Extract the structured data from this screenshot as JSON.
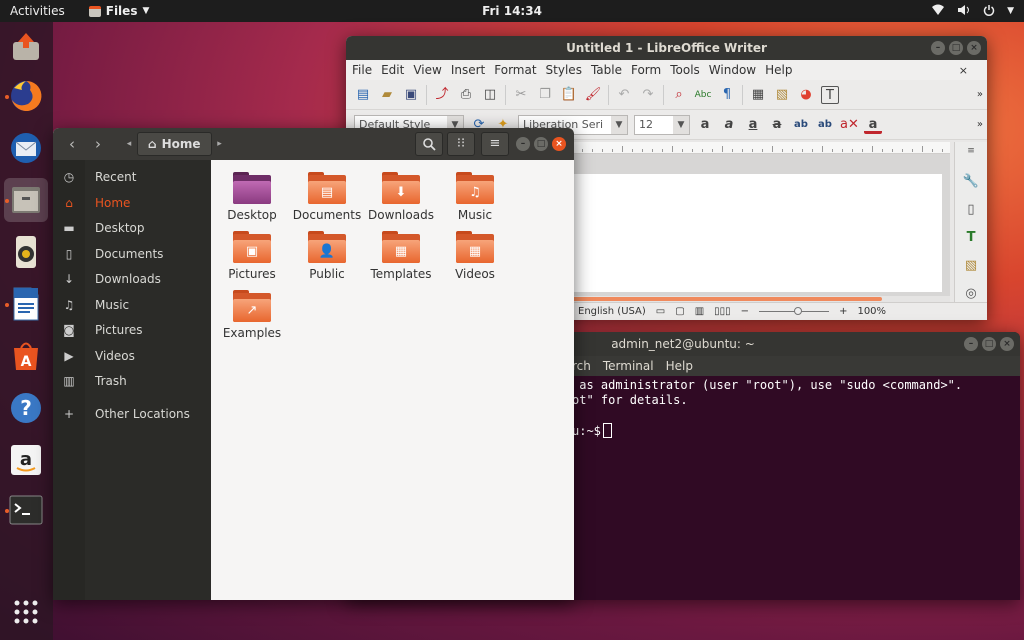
{
  "topbar": {
    "activities": "Activities",
    "app_menu": "Files",
    "clock": "Fri 14:34"
  },
  "dock": [
    "firefox-icon",
    "thunderbird-icon",
    "files-icon",
    "rhythmbox-icon",
    "writer-icon",
    "software-icon",
    "help-icon",
    "amazon-icon",
    "terminal-icon",
    "app-grid-icon"
  ],
  "writer": {
    "title": "Untitled 1 - LibreOffice Writer",
    "menu": [
      "File",
      "Edit",
      "View",
      "Insert",
      "Format",
      "Styles",
      "Table",
      "Form",
      "Tools",
      "Window",
      "Help"
    ],
    "close_doc": "×",
    "para_style": "Default Style",
    "font_name": "Liberation Seri",
    "font_size": "12",
    "language": "English (USA)",
    "zoom": "100%"
  },
  "terminal": {
    "title": "admin_net2@ubuntu: ~",
    "menu": [
      "rch",
      "Terminal",
      "Help"
    ],
    "line1": " as administrator (user \"root\"), use \"sudo <command>\".",
    "line2": "ot\" for details.",
    "prompt": "u:~$"
  },
  "files": {
    "path": "Home",
    "sidebar": [
      {
        "label": "Recent",
        "icon": "clock-icon",
        "glyph": "◷"
      },
      {
        "label": "Home",
        "icon": "home-icon",
        "glyph": "⌂"
      },
      {
        "label": "Desktop",
        "icon": "desktop-icon",
        "glyph": "▬"
      },
      {
        "label": "Documents",
        "icon": "document-icon",
        "glyph": "▯"
      },
      {
        "label": "Downloads",
        "icon": "download-icon",
        "glyph": "↓"
      },
      {
        "label": "Music",
        "icon": "music-icon",
        "glyph": "♫"
      },
      {
        "label": "Pictures",
        "icon": "camera-icon",
        "glyph": "◙"
      },
      {
        "label": "Videos",
        "icon": "video-icon",
        "glyph": "▶"
      },
      {
        "label": "Trash",
        "icon": "trash-icon",
        "glyph": "▥"
      },
      {
        "label": "Other Locations",
        "icon": "plus-icon",
        "glyph": "+"
      }
    ],
    "items": [
      {
        "label": "Desktop",
        "glyph": ""
      },
      {
        "label": "Documents",
        "glyph": "▤"
      },
      {
        "label": "Downloads",
        "glyph": "⬇"
      },
      {
        "label": "Music",
        "glyph": "♫"
      },
      {
        "label": "Pictures",
        "glyph": "▣"
      },
      {
        "label": "Public",
        "glyph": "👤"
      },
      {
        "label": "Templates",
        "glyph": "▦"
      },
      {
        "label": "Videos",
        "glyph": "▦"
      },
      {
        "label": "Examples",
        "glyph": "↗"
      }
    ]
  }
}
